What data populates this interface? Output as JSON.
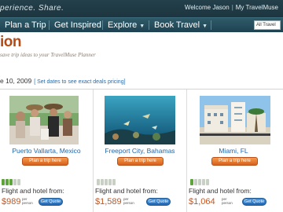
{
  "header": {
    "tagline": "perience. Share.",
    "welcome": "Welcome Jason",
    "my_link": "My TravelMuse"
  },
  "nav": {
    "items": [
      {
        "label": "Plan a Trip",
        "caret": false
      },
      {
        "label": "Get Inspired",
        "caret": false
      },
      {
        "label": "Explore",
        "caret": true
      },
      {
        "label": "Book Travel",
        "caret": true
      }
    ],
    "destination_select": "All Travel"
  },
  "page": {
    "title": "ion",
    "subtitle": "save trip ideas to your TravelMuse Planner",
    "date_text": "e 10, 2009",
    "date_link": "[ Set dates to see exact deals pricing]"
  },
  "colors": {
    "brand_orange": "#b54b14",
    "link_blue": "#2268ad",
    "nav_bg": "#24404a"
  },
  "cards": [
    {
      "city": "Puerto Vallarta, Mexico",
      "button": "Plan a trip here",
      "rating": 3,
      "rating_max": 5,
      "from_label": "Flight and hotel from:",
      "price": "$989",
      "per": "per person",
      "quote": "Get Quote"
    },
    {
      "city": "Freeport City, Bahamas",
      "button": "Plan a trip here",
      "rating": 0,
      "rating_max": 5,
      "from_label": "Flight and hotel from:",
      "price": "$1,589",
      "per": "per person",
      "quote": "Get Quote"
    },
    {
      "city": "Miami, FL",
      "button": "Plan a trip here",
      "rating": 1,
      "rating_max": 5,
      "from_label": "Flight and hotel from:",
      "price": "$1,064",
      "per": "per person",
      "quote": "Get Quote"
    }
  ]
}
